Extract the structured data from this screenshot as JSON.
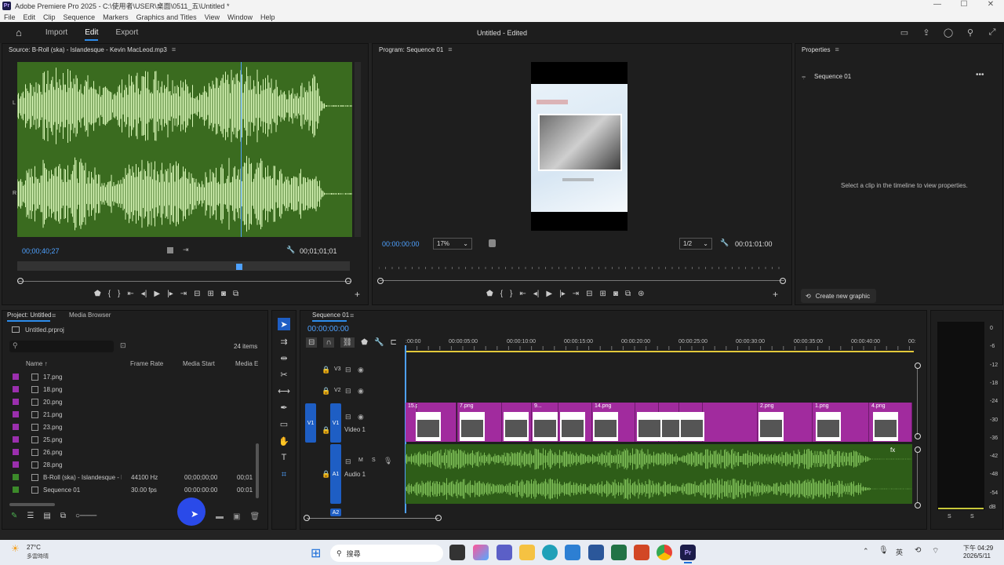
{
  "window": {
    "title": "Adobe Premiere Pro 2025 - C:\\使用者\\USER\\桌面\\0511_五\\Untitled *",
    "min": "—",
    "max": "☐",
    "close": "✕"
  },
  "menu": [
    "File",
    "Edit",
    "Clip",
    "Sequence",
    "Markers",
    "Graphics and Titles",
    "View",
    "Window",
    "Help"
  ],
  "header": {
    "nav": [
      "Import",
      "Edit",
      "Export"
    ],
    "active": "Edit",
    "doc_title": "Untitled - Edited"
  },
  "source": {
    "title": "Source: B-Roll (ska) - Islandesque - Kevin MacLeod.mp3",
    "timecode": "00;00;40;27",
    "duration": "00;01;01;01",
    "channel_l": "L",
    "channel_r": "R"
  },
  "program": {
    "title": "Program: Sequence 01",
    "timecode": "00:00:00:00",
    "zoom": "17%",
    "resolution": "1/2",
    "duration": "00:01:01:00"
  },
  "properties": {
    "title": "Properties",
    "item": "Sequence 01",
    "hint": "Select a clip in the timeline to view properties.",
    "create_graphic": "Create new graphic"
  },
  "project": {
    "tabs": [
      "Project: Untitled",
      "Media Browser"
    ],
    "file": "Untitled.prproj",
    "count": "24 items",
    "columns": [
      "Name",
      "Frame Rate",
      "Media Start",
      "Media E"
    ],
    "rows": [
      {
        "name": "17.png",
        "color": "#9b2fae",
        "rate": "",
        "start": "",
        "end": ""
      },
      {
        "name": "18.png",
        "color": "#9b2fae",
        "rate": "",
        "start": "",
        "end": ""
      },
      {
        "name": "20.png",
        "color": "#9b2fae",
        "rate": "",
        "start": "",
        "end": ""
      },
      {
        "name": "21.png",
        "color": "#9b2fae",
        "rate": "",
        "start": "",
        "end": ""
      },
      {
        "name": "23.png",
        "color": "#9b2fae",
        "rate": "",
        "start": "",
        "end": ""
      },
      {
        "name": "25.png",
        "color": "#9b2fae",
        "rate": "",
        "start": "",
        "end": ""
      },
      {
        "name": "26.png",
        "color": "#9b2fae",
        "rate": "",
        "start": "",
        "end": ""
      },
      {
        "name": "28.png",
        "color": "#9b2fae",
        "rate": "",
        "start": "",
        "end": ""
      },
      {
        "name": "B-Roll (ska) - Islandesque - K",
        "color": "#3c8a2a",
        "rate": "44100 Hz",
        "start": "00;00;00;00",
        "end": "00;01"
      },
      {
        "name": "Sequence 01",
        "color": "#3c8a2a",
        "rate": "30.00 fps",
        "start": "00:00:00:00",
        "end": "00:01"
      }
    ]
  },
  "timeline": {
    "title": "Sequence 01",
    "timecode": "00:00:00:00",
    "ticks": [
      ":00:00",
      "00:00:05:00",
      "00:00:10:00",
      "00:00:15:00",
      "00:00:20:00",
      "00:00:25:00",
      "00:00:30:00",
      "00:00:35:00",
      "00:00:40:00",
      "00:"
    ],
    "tracks": {
      "v3": "V3",
      "v2": "V2",
      "v1": "V1",
      "video1": "Video 1",
      "a1": "A1",
      "audio1": "Audio 1",
      "a2": "A2",
      "m": "M",
      "s": "S"
    },
    "clip_labels": [
      "15.png",
      "7.png",
      "9...",
      "14.png",
      "2.png",
      "1.png",
      "4.png"
    ],
    "fx": "fx"
  },
  "meters": {
    "labels": [
      "0",
      "-6",
      "-12",
      "-18",
      "-24",
      "-30",
      "-36",
      "-42",
      "-48",
      "-54"
    ],
    "db": "dB",
    "s": "S"
  },
  "taskbar": {
    "weather_temp": "27°C",
    "weather_desc": "多雲時晴",
    "search": "搜尋",
    "ime": "英",
    "time": "下午 04:29",
    "date": "2026/5/11"
  }
}
